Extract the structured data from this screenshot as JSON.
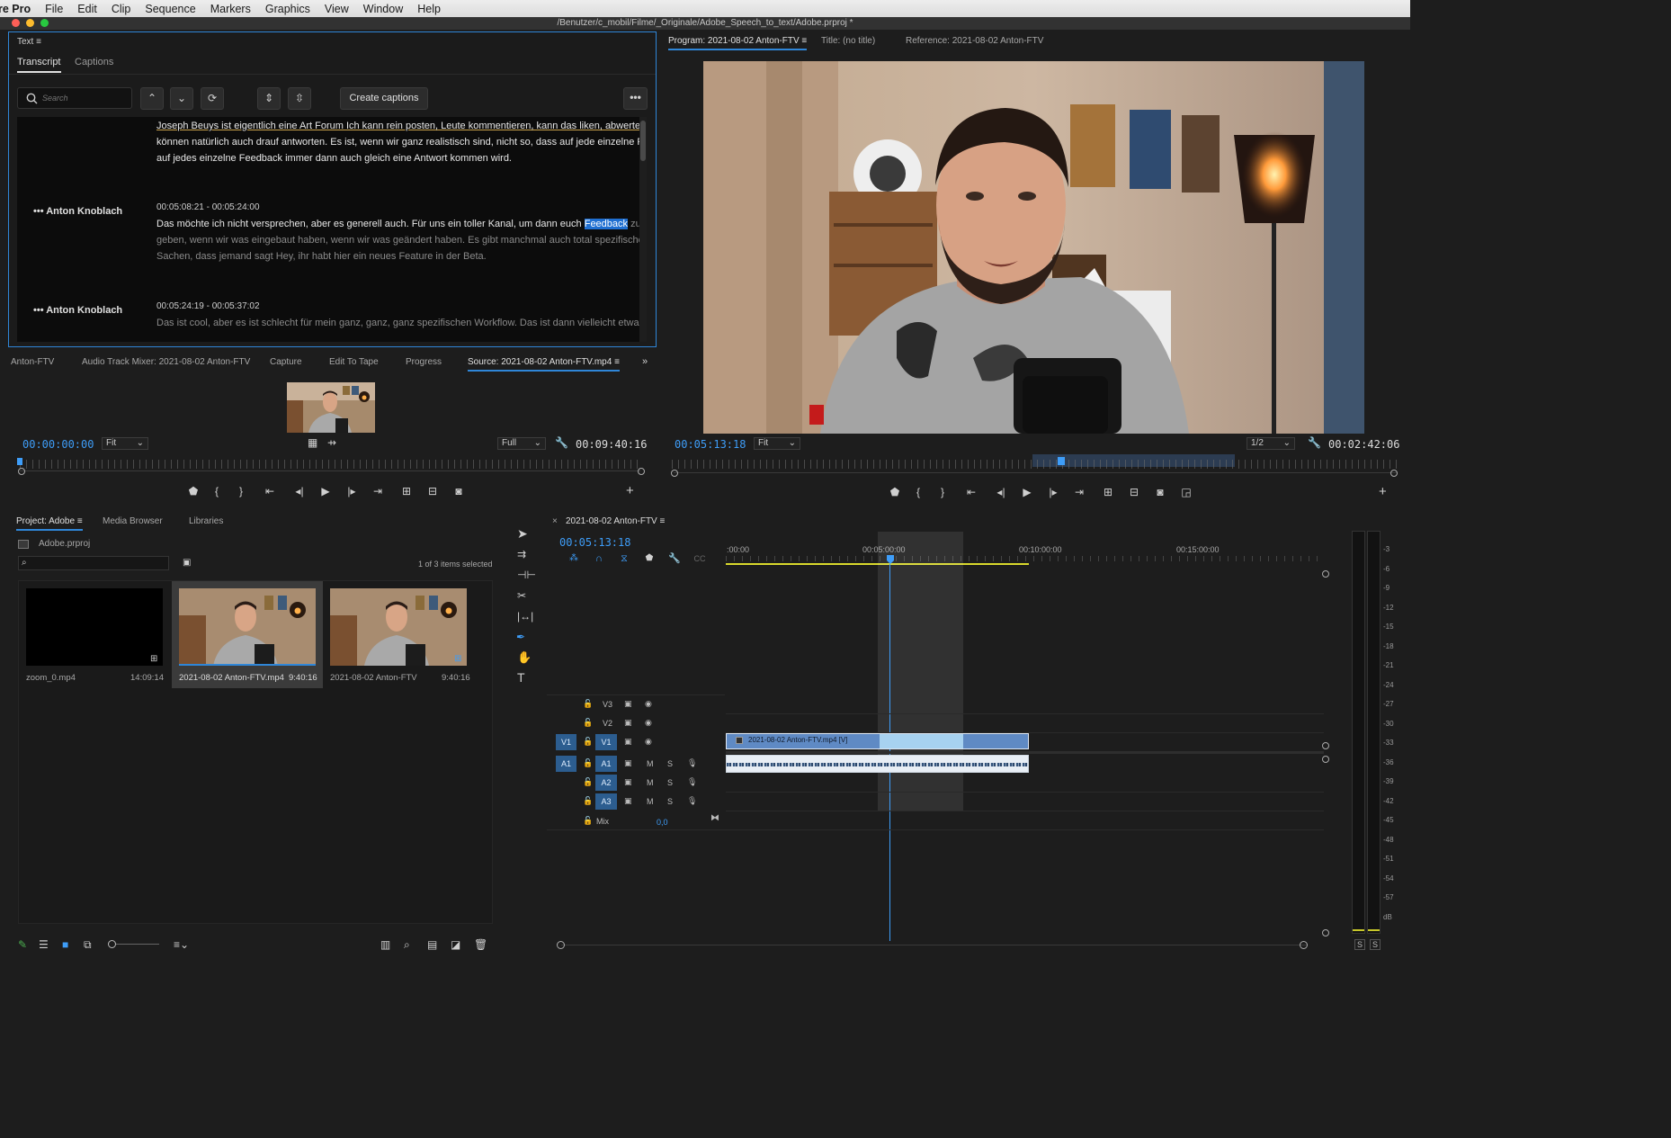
{
  "app": {
    "name": "re Pro",
    "path": "/Benutzer/c_mobil/Filme/_Originale/Adobe_Speech_to_text/Adobe.prproj *"
  },
  "menu": [
    "File",
    "Edit",
    "Clip",
    "Sequence",
    "Markers",
    "Graphics",
    "View",
    "Window",
    "Help"
  ],
  "text_panel": {
    "title": "Text",
    "tabs": [
      "Transcript",
      "Captions"
    ],
    "search_placeholder": "Search",
    "create_captions": "Create captions",
    "entries": [
      {
        "speaker": "",
        "time": "",
        "lines": [
          "Joseph Beuys ist eigentlich eine Art Forum Ich kann rein posten, Leute kommentieren, kann das liken, abwerten, wir",
          "können natürlich auch drauf antworten. Es ist, wenn wir ganz realistisch sind, nicht so, dass auf jede einzelne Frage,",
          "auf jedes einzelne Feedback immer dann auch gleich eine Antwort kommen wird."
        ]
      },
      {
        "speaker": "Anton Knoblach",
        "time": "00:05:08:21 - 00:05:24:00",
        "line1_pre": "Das möchte ich nicht versprechen, aber es generell auch. Für uns ein toller Kanal, um dann euch ",
        "highlight": "Feedback",
        "line1_post": " zu",
        "lines": [
          "geben, wenn wir was eingebaut haben, wenn wir was geändert haben. Es gibt manchmal auch total spezifische",
          "Sachen, dass jemand sagt Hey, ihr habt hier ein neues Feature in der Beta."
        ]
      },
      {
        "speaker": "Anton Knoblach",
        "time": "00:05:24:19 - 00:05:37:02",
        "lines": [
          "Das ist cool, aber es ist schlecht für mein ganz, ganz, ganz spezifischen Workflow. Das ist dann vielleicht etwas, das er"
        ]
      }
    ]
  },
  "source_panel": {
    "tabs": [
      "Anton-FTV",
      "Audio Track Mixer: 2021-08-02 Anton-FTV",
      "Capture",
      "Edit To Tape",
      "Progress",
      "Source: 2021-08-02 Anton-FTV.mp4"
    ],
    "timecode": "00:00:00:00",
    "zoom": "Fit",
    "quality": "Full",
    "duration": "00:09:40:16"
  },
  "program_panel": {
    "tabs": [
      "Program: 2021-08-02 Anton-FTV",
      "Title: (no title)",
      "Reference: 2021-08-02 Anton-FTV"
    ],
    "timecode": "00:05:13:18",
    "zoom": "Fit",
    "quality": "1/2",
    "duration": "00:02:42:06"
  },
  "project_panel": {
    "tabs": [
      "Project: Adobe",
      "Media Browser",
      "Libraries"
    ],
    "file": "Adobe.prproj",
    "count": "1 of 3 items selected",
    "items": [
      {
        "name": "zoom_0.mp4",
        "dur": "14:09:14"
      },
      {
        "name": "2021-08-02 Anton-FTV.mp4",
        "dur": "9:40:16"
      },
      {
        "name": "2021-08-02 Anton-FTV",
        "dur": "9:40:16"
      }
    ]
  },
  "timeline": {
    "title": "2021-08-02 Anton-FTV",
    "timecode": "00:05:13:18",
    "ruler": [
      ":00:00",
      "00:05:00:00",
      "00:10:00:00",
      "00:15:00:00"
    ],
    "tracks_video": [
      "V3",
      "V2",
      "V1"
    ],
    "tracks_audio": [
      "A1",
      "A2",
      "A3"
    ],
    "src_v": "V1",
    "src_a": "A1",
    "m": "M",
    "s": "S",
    "mix_label": "Mix",
    "mix_value": "0,0",
    "clip_label": "2021-08-02 Anton-FTV.mp4 [V]"
  },
  "meter": {
    "labels": [
      "-3",
      "-6",
      "-9",
      "-12",
      "-15",
      "-18",
      "-21",
      "-24",
      "-27",
      "-30",
      "-33",
      "-36",
      "-39",
      "-42",
      "-45",
      "-48",
      "-51",
      "-54",
      "-57",
      "dB"
    ],
    "solo": [
      "S",
      "S"
    ]
  }
}
